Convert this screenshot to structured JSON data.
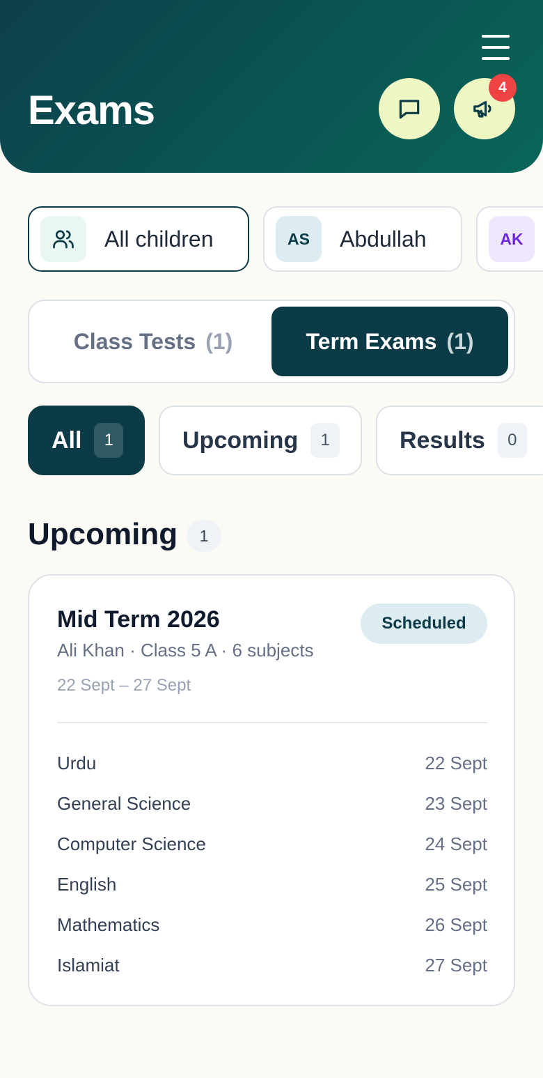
{
  "header": {
    "title": "Exams",
    "notification_count": "4",
    "icons": [
      "menu-icon",
      "chat-icon",
      "megaphone-icon"
    ]
  },
  "children_filter": [
    {
      "avatar": "",
      "label": "All children",
      "active": true
    },
    {
      "avatar": "AS",
      "label": "Abdullah",
      "active": false
    },
    {
      "avatar": "AK",
      "label": "",
      "active": false
    }
  ],
  "exam_type_tabs": [
    {
      "label": "Class Tests",
      "count": "(1)",
      "active": false
    },
    {
      "label": "Term Exams",
      "count": "(1)",
      "active": true
    }
  ],
  "status_filters": [
    {
      "label": "All",
      "count": "1",
      "active": true
    },
    {
      "label": "Upcoming",
      "count": "1",
      "active": false
    },
    {
      "label": "Results",
      "count": "0",
      "active": false
    }
  ],
  "section": {
    "title": "Upcoming",
    "count": "1"
  },
  "exam_card": {
    "title": "Mid Term 2026",
    "status": "Scheduled",
    "meta": "Ali Khan · Class 5 A · 6 subjects",
    "date_range": "22 Sept – 27 Sept",
    "subjects": [
      {
        "name": "Urdu",
        "date": "22 Sept"
      },
      {
        "name": "General Science",
        "date": "23 Sept"
      },
      {
        "name": "Computer Science",
        "date": "24 Sept"
      },
      {
        "name": "English",
        "date": "25 Sept"
      },
      {
        "name": "Mathematics",
        "date": "26 Sept"
      },
      {
        "name": "Islamiat",
        "date": "27 Sept"
      }
    ]
  },
  "colors": {
    "header_bg": "#0c3f4c",
    "accent_dark": "#0c3b48",
    "action_button_bg": "#eef6c4",
    "badge_red": "#ef4444",
    "page_bg": "#fbfaf4"
  }
}
